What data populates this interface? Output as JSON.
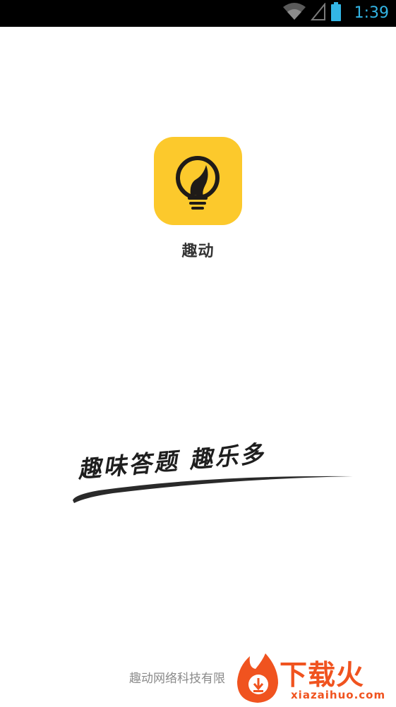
{
  "status_bar": {
    "time": "1:39",
    "icons": [
      "wifi-icon",
      "cell-signal-icon",
      "battery-icon"
    ],
    "time_color": "#33b5e5"
  },
  "app": {
    "icon_name": "lightbulb-icon",
    "icon_color": "#fcc92c",
    "name": "趣动"
  },
  "slogan": {
    "text": "趣味答题 趣乐多"
  },
  "footer": {
    "company": "趣动网络科技有限"
  },
  "watermark": {
    "icon_name": "fire-download-icon",
    "text_cn": "下载火",
    "text_en": "xiazaihuo.com",
    "color": "#f0531f"
  }
}
